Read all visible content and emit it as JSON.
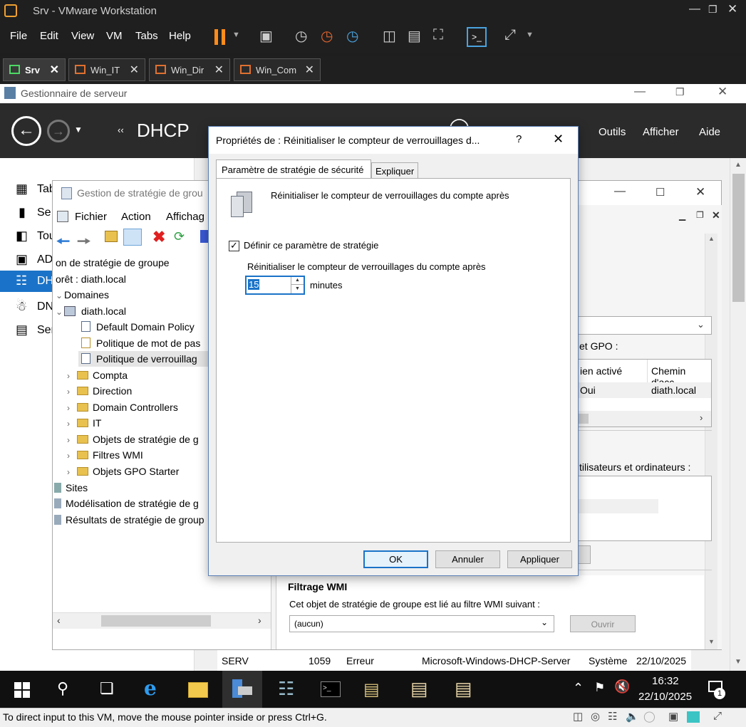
{
  "vmware": {
    "title": "Srv - VMware Workstation",
    "menu": [
      "File",
      "Edit",
      "View",
      "VM",
      "Tabs",
      "Help"
    ],
    "tabs": [
      "Srv",
      "Win_IT",
      "Win_Dir",
      "Win_Com"
    ],
    "status_text": "To direct input to this VM, move the mouse pointer inside or press Ctrl+G."
  },
  "server_manager": {
    "title": "Gestionnaire de serveur",
    "breadcrumb": "DHCP",
    "header_menu": [
      "Outils",
      "Afficher",
      "Aide"
    ],
    "sidebar": [
      "Tab",
      "Se",
      "Tou",
      "AD",
      "DH",
      "DN",
      "Ser"
    ],
    "events_row": {
      "server": "SERV",
      "id": "1059",
      "level": "Erreur",
      "source": "Microsoft-Windows-DHCP-Server",
      "log": "Système",
      "date": "22/10/2025"
    }
  },
  "gpm": {
    "title": "Gestion de stratégie de grou",
    "menu": [
      "Fichier",
      "Action",
      "Affichag"
    ],
    "tree": {
      "root": "on de stratégie de groupe",
      "forest": "orêt : diath.local",
      "domains": "Domaines",
      "domain": "diath.local",
      "items": [
        "Default Domain Policy",
        "Politique de mot de pas",
        "Politique de verrouillag"
      ],
      "ous": [
        "Compta",
        "Direction",
        "Domain Controllers",
        "IT",
        "Objets de stratégie de g",
        "Filtres WMI",
        "Objets GPO Starter"
      ],
      "sites": "Sites",
      "modeling": "Modélisation de stratégie de g",
      "results": "Résultats de stratégie de group"
    },
    "right": {
      "links_label": "et GPO :",
      "col_enabled": "ien activé",
      "col_path": "Chemin d'acc",
      "row_enabled": "Oui",
      "row_path": "diath.local",
      "security_label": "tilisateurs et ordinateurs :",
      "wmi_title": "Filtrage WMI",
      "wmi_text": "Cet objet de stratégie de groupe est lié au filtre WMI suivant :",
      "wmi_select": "(aucun)",
      "wmi_button": "Ouvrir"
    }
  },
  "dialog": {
    "title": "Propriétés de : Réinitialiser le compteur de verrouillages d...",
    "help": "?",
    "tabs": [
      "Paramètre de stratégie de sécurité",
      "Expliquer"
    ],
    "policy_name": "Réinitialiser le compteur de verrouillages du compte après",
    "define_label": "Définir ce paramètre de stratégie",
    "field_label": "Réinitialiser le compteur de verrouillages du compte après",
    "value": "15",
    "unit": "minutes",
    "ok": "OK",
    "cancel": "Annuler",
    "apply": "Appliquer"
  },
  "taskbar": {
    "time": "16:32",
    "date": "22/10/2025",
    "notif_count": "1"
  }
}
